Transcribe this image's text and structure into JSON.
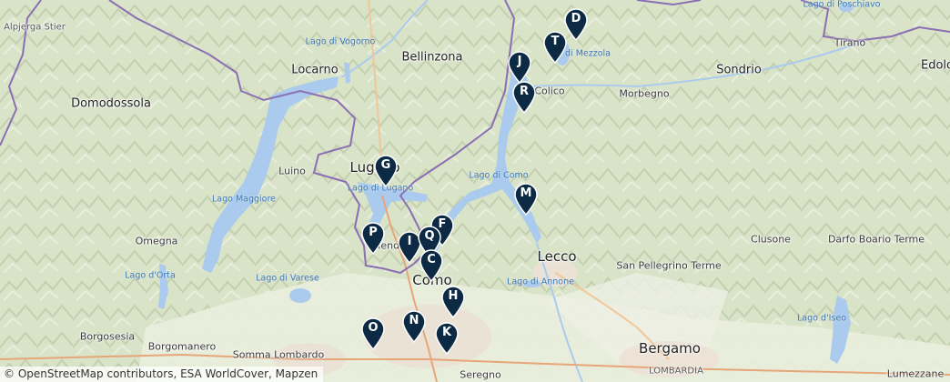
{
  "labels": {
    "alpjerga": "Alpjerga Stier",
    "lago_vogorno": "Lago di Vogorno",
    "bellinzona": "Bellinzona",
    "locarno": "Locarno",
    "domodossola": "Domodossola",
    "luino": "Luino",
    "lugano": "Lugano",
    "lago_lugano": "Lago di Lugano",
    "lago_maggiore": "Lago Maggiore",
    "omegna": "Omegna",
    "lago_orta": "Lago d'Orta",
    "lago_varese": "Lago di Varese",
    "borgosesia": "Borgosesia",
    "borgomanero": "Borgomanero",
    "somma": "Somma Lombardo",
    "mendrisio": "Mend",
    "como": "Como",
    "lago_mezzola": "di Mezzola",
    "colico": "Colico",
    "morbegno": "Morbegno",
    "sondrio": "Sondrio",
    "tirano": "Tirano",
    "edolo": "Edolo",
    "lago_poschiavo": "Lago di Poschiavo",
    "lago_como": "Lago di Como",
    "lecco": "Lecco",
    "lago_annone": "Lago di Annone",
    "clusone": "Clusone",
    "darfo": "Darfo Boario Terme",
    "san_pellegrino": "San Pellegrino Terme",
    "lago_iseo": "Lago d'Iseo",
    "bergamo": "Bergamo",
    "lombardia": "LOMBARDIA",
    "seregno": "Seregno",
    "lumezzane": "Lumezzane"
  },
  "markers": [
    {
      "letter": "D"
    },
    {
      "letter": "T"
    },
    {
      "letter": "J"
    },
    {
      "letter": "R"
    },
    {
      "letter": "G"
    },
    {
      "letter": "M"
    },
    {
      "letter": "F"
    },
    {
      "letter": "P"
    },
    {
      "letter": "I"
    },
    {
      "letter": "Q"
    },
    {
      "letter": "C"
    },
    {
      "letter": "H"
    },
    {
      "letter": "N"
    },
    {
      "letter": "O"
    },
    {
      "letter": "K"
    }
  ],
  "colors": {
    "marker": "#0d2a45",
    "water": "#aacbed",
    "border": "#8a6fb3"
  },
  "attribution": "© OpenStreetMap contributors, ESA WorldCover, Mapzen"
}
